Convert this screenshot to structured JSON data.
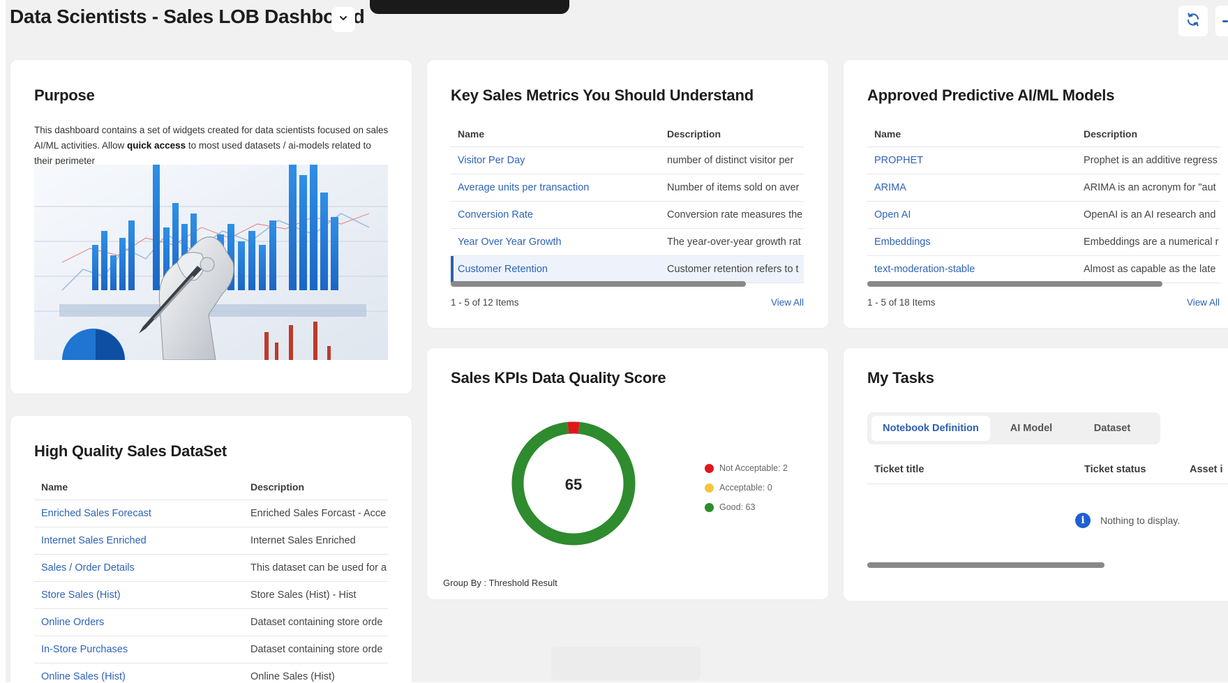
{
  "header": {
    "title": "Data Scientists - Sales LOB Dashboard"
  },
  "colors": {
    "link": "#2e63b8",
    "accent": "#2f5fb0",
    "not_acceptable": "#e0161e",
    "acceptable": "#f5c542",
    "good": "#2e8b2e"
  },
  "purpose": {
    "title": "Purpose",
    "text_before": "This dashboard contains a set of widgets created for data scientists focused on sales AI/ML activities. Allow ",
    "text_bold": "quick access",
    "text_after": " to most used datasets / ai-models related to their perimeter"
  },
  "key_metrics": {
    "title": "Key Sales Metrics You Should Understand",
    "columns": [
      "Name",
      "Description"
    ],
    "rows": [
      {
        "name": "Visitor Per Day",
        "description": "number of distinct visitor per"
      },
      {
        "name": "Average units per transaction",
        "description": "Number of items sold on aver"
      },
      {
        "name": "Conversion Rate",
        "description": "Conversion rate measures the"
      },
      {
        "name": "Year Over Year Growth",
        "description": "The year-over-year growth rat"
      },
      {
        "name": "Customer Retention",
        "description": "Customer retention refers to t"
      }
    ],
    "pager": "1 - 5 of 12 Items",
    "view_all": "View All"
  },
  "models": {
    "title": "Approved Predictive AI/ML Models",
    "columns": [
      "Name",
      "Description"
    ],
    "rows": [
      {
        "name": "PROPHET",
        "description": "Prophet is an additive regress"
      },
      {
        "name": "ARIMA",
        "description": "ARIMA is an acronym for \"aut"
      },
      {
        "name": "Open AI",
        "description": "OpenAI is an AI research and"
      },
      {
        "name": "Embeddings",
        "description": "Embeddings are a numerical r"
      },
      {
        "name": "text-moderation-stable",
        "description": "Almost as capable as the late"
      }
    ],
    "pager": "1 - 5 of 18 Items",
    "view_all": "View All"
  },
  "datasets": {
    "title": "High Quality Sales DataSet",
    "columns": [
      "Name",
      "Description"
    ],
    "rows": [
      {
        "name": "Enriched Sales Forecast",
        "description": "Enriched Sales Forcast - Acce"
      },
      {
        "name": "Internet Sales Enriched",
        "description": "Internet Sales Enriched"
      },
      {
        "name": "Sales / Order Details",
        "description": "This dataset can be used for a"
      },
      {
        "name": "Store Sales (Hist)",
        "description": "Store Sales (Hist) - Hist"
      },
      {
        "name": "Online Orders",
        "description": "Dataset containing store orde"
      },
      {
        "name": "In-Store Purchases",
        "description": "Dataset containing store orde"
      },
      {
        "name": "Online Sales (Hist)",
        "description": "Online Sales (Hist)"
      }
    ]
  },
  "quality": {
    "title": "Sales KPIs Data Quality Score",
    "score": "65",
    "legend": [
      {
        "label": "Not Acceptable: 2",
        "value": 2,
        "color": "#e0161e"
      },
      {
        "label": "Acceptable: 0",
        "value": 0,
        "color": "#f5c542"
      },
      {
        "label": "Good: 63",
        "value": 63,
        "color": "#2e8b2e"
      }
    ],
    "group_by": "Group By : Threshold Result"
  },
  "chart_data": {
    "type": "pie",
    "title": "Sales KPIs Data Quality Score",
    "categories": [
      "Not Acceptable",
      "Acceptable",
      "Good"
    ],
    "values": [
      2,
      0,
      63
    ],
    "total": 65,
    "legend_position": "right"
  },
  "tasks": {
    "title": "My Tasks",
    "tabs": [
      "Notebook Definition",
      "AI Model",
      "Dataset"
    ],
    "active_tab": "Notebook Definition",
    "columns": [
      "Ticket title",
      "Ticket status",
      "Asset i"
    ],
    "empty_message": "Nothing to display."
  },
  "icons": {
    "dropdown": "chevron-down-icon",
    "refresh": "refresh-icon",
    "more": "more-icon",
    "info": "info-icon"
  }
}
